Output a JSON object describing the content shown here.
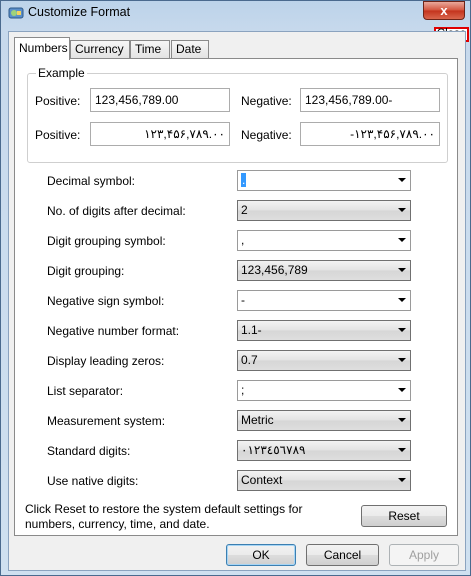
{
  "window": {
    "title": "Customize Format",
    "close_glyph": "x",
    "close_label": "Close"
  },
  "tabs": [
    {
      "label": "Numbers",
      "active": true
    },
    {
      "label": "Currency",
      "active": false
    },
    {
      "label": "Time",
      "active": false
    },
    {
      "label": "Date",
      "active": false
    }
  ],
  "example": {
    "title": "Example",
    "positive_label": "Positive:",
    "negative_label": "Negative:",
    "positive_value": "123,456,789.00",
    "negative_value": "123,456,789.00-",
    "positive_native": "۱۲۳,۴۵۶,۷۸۹.۰۰",
    "negative_native": "-۱۲۳,۴۵۶,۷۸۹.۰۰"
  },
  "settings": [
    {
      "label": "Decimal symbol:",
      "value": ".",
      "style": "editable"
    },
    {
      "label": "No. of digits after decimal:",
      "value": "2",
      "style": "dropdown"
    },
    {
      "label": "Digit grouping symbol:",
      "value": ",",
      "style": "editable"
    },
    {
      "label": "Digit grouping:",
      "value": "123,456,789",
      "style": "dropdown"
    },
    {
      "label": "Negative sign symbol:",
      "value": "-",
      "style": "editable"
    },
    {
      "label": "Negative number format:",
      "value": "1.1-",
      "style": "dropdown"
    },
    {
      "label": "Display leading zeros:",
      "value": "0.7",
      "style": "dropdown"
    },
    {
      "label": "List separator:",
      "value": ";",
      "style": "editable"
    },
    {
      "label": "Measurement system:",
      "value": "Metric",
      "style": "dropdown"
    },
    {
      "label": "Standard digits:",
      "value": "٠١٢٣٤٥٦٧٨٩",
      "style": "dropdown"
    },
    {
      "label": "Use native digits:",
      "value": "Context",
      "style": "dropdown"
    }
  ],
  "reset": {
    "note": "Click Reset to restore the system default settings for numbers, currency, time, and date.",
    "button": "Reset"
  },
  "footer": {
    "ok": "OK",
    "cancel": "Cancel",
    "apply": "Apply"
  }
}
